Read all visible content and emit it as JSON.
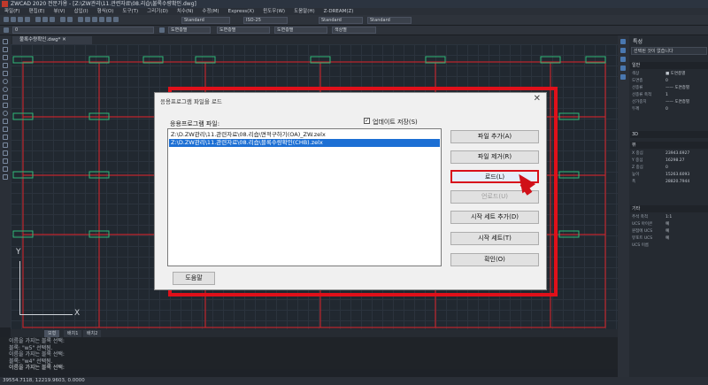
{
  "window": {
    "title": "ZWCAD 2020 전문가용 - [Z:\\ZW관리\\11.관련자료\\08.리습\\불록수량확인.dwg]"
  },
  "menu": [
    "파일(F)",
    "편집(E)",
    "뷰(V)",
    "삽입(I)",
    "형식(O)",
    "도구(T)",
    "그리기(D)",
    "치수(N)",
    "수정(M)",
    "Express(X)",
    "윈도우(W)",
    "도움말(H)",
    "Z-DREAM(Z)"
  ],
  "toolbar": {
    "style1": "Standard",
    "dimstyle": "ISO-25",
    "style2": "Standard",
    "style3": "Standard",
    "layer": "0",
    "bylayer1": "도면층별",
    "bylayer2": "도면층별",
    "bylayer3": "도면층별",
    "color": "색상별"
  },
  "doc_tab": "불록수량확인.dwg*",
  "layout_tabs": [
    "모형",
    "배치1",
    "배치2"
  ],
  "command": {
    "lines": [
      "이름을 가지는 블록 선택:",
      "블록: \"w5\" 선택됨.",
      "이름을 가지는 블록 선택:",
      "블록: \"w4\" 선택됨."
    ],
    "prompt": "이름을 가지는 블록 선택:"
  },
  "status": {
    "coords": "39554.7118, 12219.9603, 0.0000"
  },
  "properties": {
    "title": "특성",
    "selection": "선택된 것이 없습니다",
    "sections": {
      "general": "일반",
      "3d": "3D",
      "view": "뷰",
      "misc": "기타"
    },
    "general_rows": [
      {
        "k": "색상",
        "v": "■ 도면층별"
      },
      {
        "k": "도면층",
        "v": "0"
      },
      {
        "k": "선종류",
        "v": "—— 도면층별"
      },
      {
        "k": "선종류 축척",
        "v": "1"
      },
      {
        "k": "선가중치",
        "v": "—— 도면층별"
      },
      {
        "k": "두께",
        "v": "0"
      }
    ],
    "view_rows": [
      {
        "k": "X 중심",
        "v": "23943.6927"
      },
      {
        "k": "Y 중심",
        "v": "16298.27"
      },
      {
        "k": "Z 중심",
        "v": "0"
      },
      {
        "k": "높이",
        "v": "15263.6093"
      },
      {
        "k": "폭",
        "v": "28820.7944"
      }
    ],
    "misc_rows": [
      {
        "k": "주석 축척",
        "v": "1:1"
      },
      {
        "k": "UCS 아이콘",
        "v": "예"
      },
      {
        "k": "원점에 UCS",
        "v": "예"
      },
      {
        "k": "뷰포트 UCS",
        "v": "예"
      },
      {
        "k": "UCS 이름",
        "v": ""
      }
    ]
  },
  "dialog": {
    "title": "응용프로그램 파일을 로드",
    "close": "✕",
    "list_label": "응용프로그램 파일:",
    "checkbox_label": "업데이트 저장(S)",
    "files": [
      "Z:\\D.ZW관리\\11.관련자료\\08.리습\\면적구하기(OA)_ZW.zelx",
      "Z:\\D.ZW관리\\11.관련자료\\08.리습\\블록수량확인(CHB).zelx"
    ],
    "buttons": {
      "add": "파일 추가(A)",
      "remove": "파일 제거(R)",
      "load": "로드(L)",
      "unload": "언로드(U)",
      "add_startup": "시작 세트 추가(D)",
      "startup": "시작 세트(T)",
      "ok": "확인(O)",
      "help": "도움말"
    }
  },
  "ucs": {
    "x": "X",
    "y": "Y"
  },
  "colors": {
    "highlight": "#e0101a",
    "selection": "#1c6fd4",
    "wall": "#c0262c",
    "block": "#2fb878"
  }
}
